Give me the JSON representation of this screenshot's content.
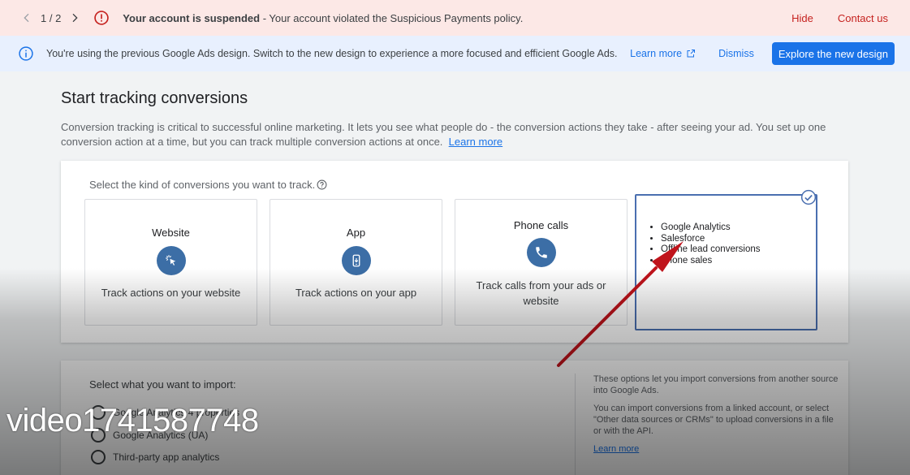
{
  "alert": {
    "page_count": "1 / 2",
    "title": "Your account is suspended",
    "message": " - Your account violated the Suspicious Payments policy.",
    "hide_label": "Hide",
    "contact_label": "Contact us"
  },
  "banner": {
    "text": "You're using the previous Google Ads design. Switch to the new design to experience a more focused and efficient Google Ads.",
    "learn_more": "Learn more",
    "dismiss": "Dismiss",
    "explore": "Explore the new design"
  },
  "main": {
    "title": "Start tracking conversions",
    "description": "Conversion tracking is critical to successful online marketing. It lets you see what people do - the conversion actions they take - after seeing your ad. You set up one conversion action at a time, but you can track multiple conversion actions at once.",
    "learn_more": "Learn more",
    "prompt": "Select the kind of conversions you want to track.",
    "cards": [
      {
        "title": "Website",
        "subtitle": "Track actions on your website",
        "icon": "cursor-click-icon"
      },
      {
        "title": "App",
        "subtitle": "Track actions on your app",
        "icon": "phone-app-icon"
      },
      {
        "title": "Phone calls",
        "subtitle": "Track calls from your ads or website",
        "icon": "phone-icon"
      }
    ],
    "import_card": {
      "items": [
        "Google Analytics",
        "Salesforce",
        "Offline lead conversions",
        "Phone sales"
      ],
      "icon": "check-circle-icon"
    }
  },
  "import": {
    "title": "Select what you want to import:",
    "options": [
      "Google Analytics 4 properties",
      "Google Analytics (UA)",
      "Third-party app analytics"
    ],
    "side_text_1": "These options let you import conversions from another source into Google Ads.",
    "side_text_2": "You can import conversions from a linked account, or select \"Other data sources or CRMs\" to upload conversions in a file or with the API.",
    "side_learn": "Learn more"
  },
  "watermark": "video1741587748",
  "colors": {
    "alert_bg": "#fce8e6",
    "alert_link": "#c5221f",
    "banner_bg": "#e8f0fe",
    "primary": "#1a73e8",
    "icon_circle": "#3c6ea6",
    "selected_border": "#4a6fb0",
    "arrow": "#c0141c"
  }
}
